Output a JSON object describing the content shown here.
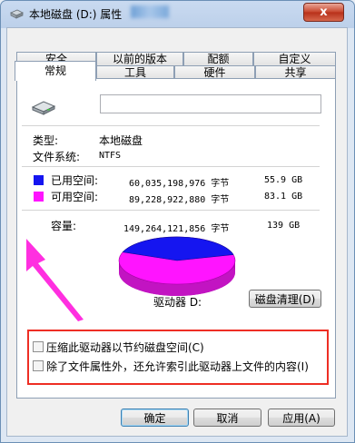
{
  "window": {
    "title": "本地磁盘 (D:) 属性",
    "close_label": "x"
  },
  "tabs_row1": [
    "安全",
    "以前的版本",
    "配额",
    "自定义"
  ],
  "tabs_row2": [
    "常规",
    "工具",
    "硬件",
    "共享"
  ],
  "drive": {
    "name_value": ""
  },
  "info": {
    "type_label": "类型:",
    "type_value": "本地磁盘",
    "fs_label": "文件系统:",
    "fs_value": "NTFS"
  },
  "usage": {
    "used_label": "已用空间:",
    "used_bytes": "60,035,198,976 字节",
    "used_gb": "55.9 GB",
    "free_label": "可用空间:",
    "free_bytes": "89,228,922,880 字节",
    "free_gb": "83.1 GB",
    "cap_label": "容量:",
    "cap_bytes": "149,264,121,856 字节",
    "cap_gb": "139 GB",
    "used_color": "#1515f0",
    "free_color": "#ff14ff",
    "used_fraction": 0.402
  },
  "drive_label": "驱动器 D:",
  "cleanup_button": "磁盘清理(D)",
  "options": {
    "compress": "压缩此驱动器以节约磁盘空间(C)",
    "index": "除了文件属性外，还允许索引此驱动器上文件的内容(I)"
  },
  "buttons": {
    "ok": "确定",
    "cancel": "取消",
    "apply": "应用(A)"
  }
}
